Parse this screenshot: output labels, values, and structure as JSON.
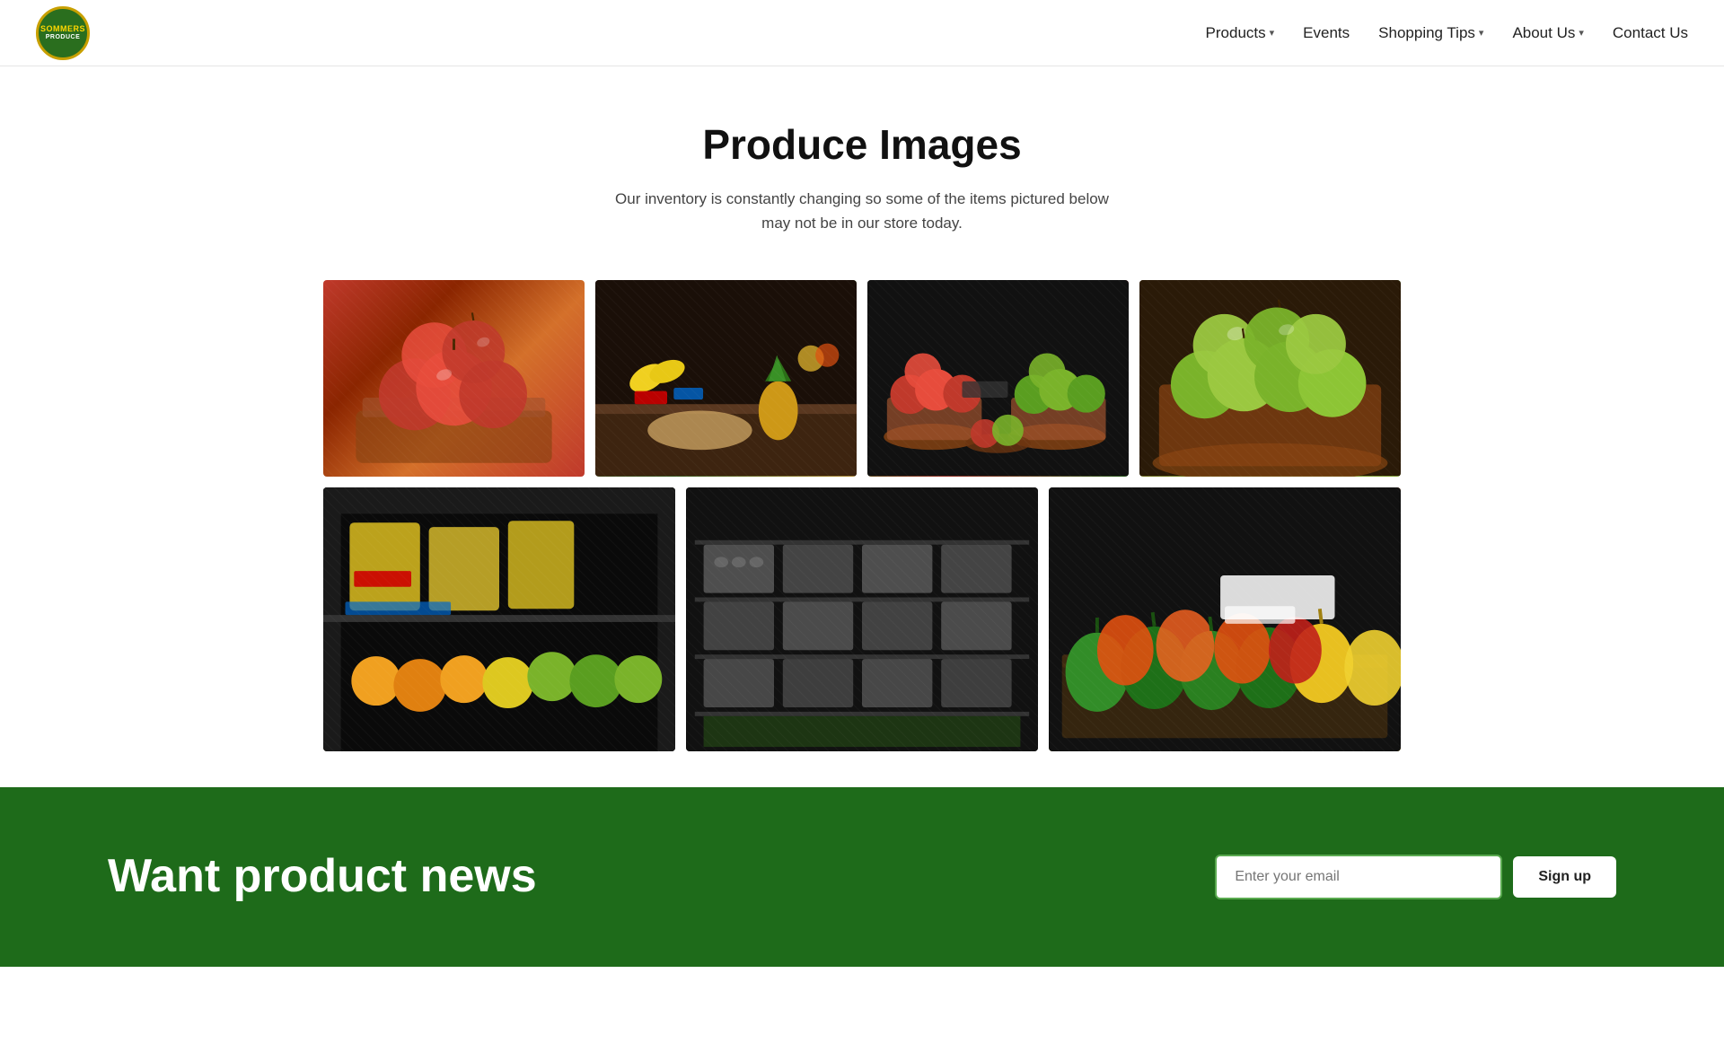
{
  "header": {
    "logo_text_top": "SOMMERS",
    "logo_text_mid": "PRODUCE",
    "nav": {
      "products_label": "Products",
      "events_label": "Events",
      "shopping_tips_label": "Shopping Tips",
      "about_us_label": "About Us",
      "contact_us_label": "Contact Us"
    }
  },
  "main": {
    "page_title": "Produce Images",
    "page_subtitle": "Our inventory is constantly changing so some of the items pictured below\nmay not be in our store today.",
    "images": [
      {
        "id": "img1",
        "alt": "Red apples in wooden basket",
        "type": "produce-apples-red"
      },
      {
        "id": "img2",
        "alt": "Produce market with pineapples and ginger",
        "type": "produce-market"
      },
      {
        "id": "img3",
        "alt": "Mixed apples in bushel baskets",
        "type": "produce-apples-mixed"
      },
      {
        "id": "img4",
        "alt": "Green apples in basket",
        "type": "produce-apples-green"
      },
      {
        "id": "img5",
        "alt": "Citrus fruits and lemons on shelf",
        "type": "produce-citrus"
      },
      {
        "id": "img6",
        "alt": "Dairy and packaged goods on shelves",
        "type": "produce-dairy"
      },
      {
        "id": "img7",
        "alt": "Green and orange bell peppers",
        "type": "produce-peppers"
      }
    ]
  },
  "footer": {
    "title": "Want product news",
    "email_placeholder": "Enter your email",
    "signup_label": "Sign up"
  }
}
